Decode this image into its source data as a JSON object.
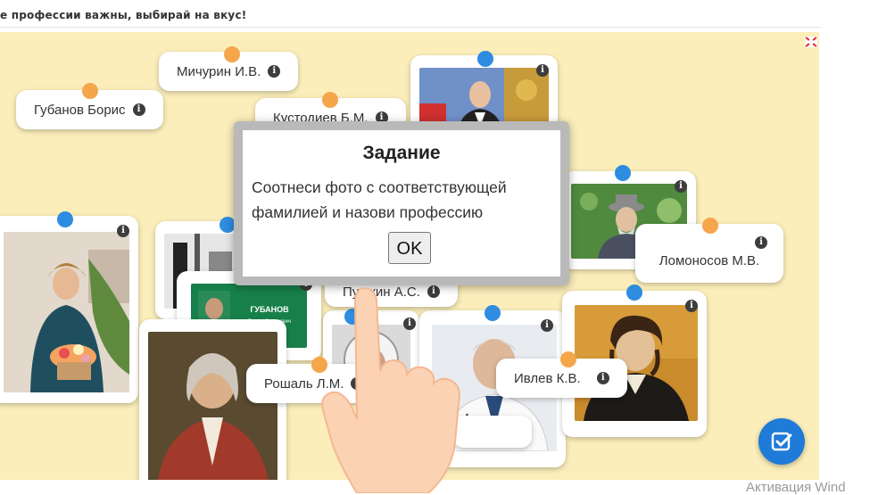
{
  "header": {
    "instruction": "е профессии важны, выбирай на вкус!"
  },
  "board": {
    "background_color": "#fbeeba",
    "photo_cards": [
      {
        "id": "putin",
        "desc": "man in suit"
      },
      {
        "id": "woman_flowers",
        "desc": "woman with flowers"
      },
      {
        "id": "bw_photo",
        "desc": "black and white photo"
      },
      {
        "id": "gubanov_screen",
        "desc": "Губанов Борис Сергеевич banner",
        "caption_name": "ГУБАНОВ",
        "caption_sub": "Борис Сергеевич"
      },
      {
        "id": "lomonosov_portrait",
        "desc": "portrait in red coat"
      },
      {
        "id": "michurin_photo",
        "desc": "old man in hat"
      },
      {
        "id": "gagarin_photo",
        "desc": "astronaut"
      },
      {
        "id": "roshal_photo",
        "desc": "doctor"
      },
      {
        "id": "pushkin_portrait",
        "desc": "Pushkin portrait"
      },
      {
        "id": "bottom_card",
        "desc": "card"
      }
    ],
    "labels": [
      {
        "id": "michurin",
        "text": "Мичурин И.В."
      },
      {
        "id": "gubanov",
        "text": "Губанов Борис"
      },
      {
        "id": "kustodiev",
        "text": "Кустодиев Б.М."
      },
      {
        "id": "lomonosov",
        "text": "Ломоносов М.В."
      },
      {
        "id": "pushkin",
        "text": "Пушкин А.С."
      },
      {
        "id": "roshal",
        "text": "Рошаль Л.М."
      },
      {
        "id": "ivlev",
        "text": "Ивлев К.В."
      }
    ],
    "info_glyph": "i"
  },
  "modal": {
    "title": "Задание",
    "text": "Соотнеси фото с соответствующей фамилией и назови профессию",
    "ok_label": "OK"
  },
  "submit_button": {
    "icon": "check-square-icon"
  },
  "watermark": "Активация Wind"
}
